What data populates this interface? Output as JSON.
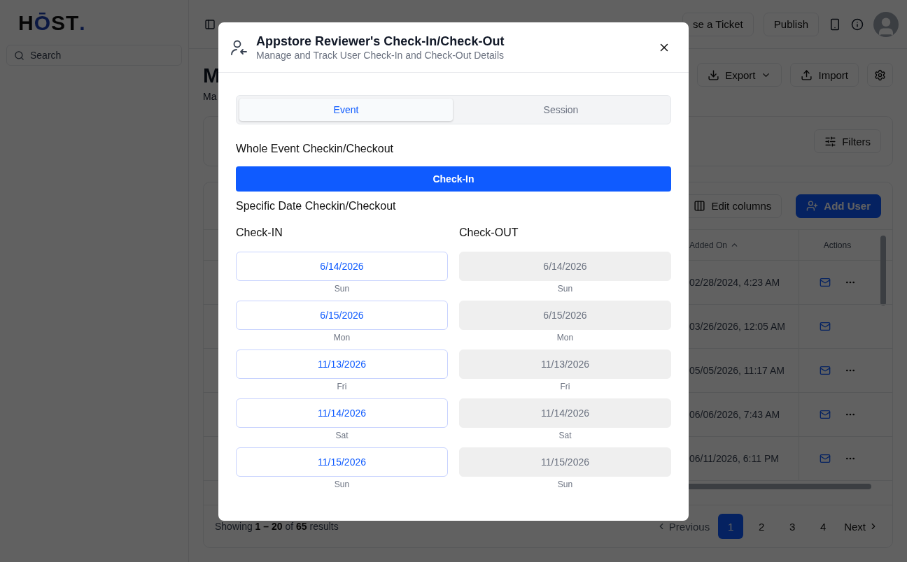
{
  "sidebar": {
    "logo": {
      "letters": [
        "H",
        "Ō",
        "S",
        "T",
        "."
      ]
    },
    "search": {
      "placeholder": "Search"
    }
  },
  "topbar": {
    "buttons": [
      "se a Ticket",
      "Publish"
    ]
  },
  "page": {
    "title": "M",
    "subtitle": "Ma",
    "actions": [
      {
        "kind": "export",
        "label": "Export"
      },
      {
        "kind": "import",
        "label": "Import"
      },
      {
        "kind": "settings"
      }
    ]
  },
  "filters": {
    "label": "Filters"
  },
  "table": {
    "toolbar": [
      {
        "kind": "columns",
        "label": "Edit columns"
      },
      {
        "kind": "add",
        "label": "Add User"
      }
    ],
    "columns": [
      {
        "label": "Added On",
        "sorted": true
      },
      {
        "label": "Actions",
        "sorted": false
      }
    ],
    "rows": [
      {
        "added_on": "02/28/2024, 4:23 AM",
        "more": true
      },
      {
        "added_on": "03/26/2026, 12:05 AM",
        "more": false
      },
      {
        "added_on": "05/05/2026, 11:17 AM",
        "more": true
      },
      {
        "added_on": "06/06/2026, 7:43 AM",
        "more": true
      },
      {
        "added_on": "06/11/2026, 6:11 PM",
        "more": true
      }
    ],
    "footer": {
      "summary": "Showing **1 – 20** of **65** results",
      "previous": "Previous",
      "pages": [
        {
          "label": "1",
          "selected": true
        },
        {
          "label": "2",
          "selected": false
        },
        {
          "label": "3",
          "selected": false
        },
        {
          "label": "4",
          "selected": false
        }
      ],
      "next": "Next"
    }
  },
  "dialog": {
    "title": "Appstore Reviewer's Check-In/Check-Out",
    "subtitle": "Manage and Track User Check-In and Check-Out Details",
    "tabs": [
      {
        "label": "Event",
        "selected": true
      },
      {
        "label": "Session",
        "selected": false
      }
    ],
    "whole_event": {
      "heading": "Whole Event Checkin/Checkout",
      "button": "Check-In"
    },
    "specific": {
      "heading": "Specific Date Checkin/Checkout",
      "columns": [
        "Check-IN",
        "Check-OUT"
      ],
      "rows": [
        {
          "check_in": {
            "date": "6/14/2026",
            "day": "Sun",
            "disabled": false
          },
          "check_out": {
            "date": "6/14/2026",
            "day": "Sun",
            "disabled": true
          }
        },
        {
          "check_in": {
            "date": "6/15/2026",
            "day": "Mon",
            "disabled": false
          },
          "check_out": {
            "date": "6/15/2026",
            "day": "Mon",
            "disabled": true
          }
        },
        {
          "check_in": {
            "date": "11/13/2026",
            "day": "Fri",
            "disabled": false
          },
          "check_out": {
            "date": "11/13/2026",
            "day": "Fri",
            "disabled": true
          }
        },
        {
          "check_in": {
            "date": "11/14/2026",
            "day": "Sat",
            "disabled": false
          },
          "check_out": {
            "date": "11/14/2026",
            "day": "Sat",
            "disabled": true
          }
        },
        {
          "check_in": {
            "date": "11/15/2026",
            "day": "Sun",
            "disabled": false
          },
          "check_out": {
            "date": "11/15/2026",
            "day": "Sun",
            "disabled": true
          }
        }
      ]
    }
  }
}
